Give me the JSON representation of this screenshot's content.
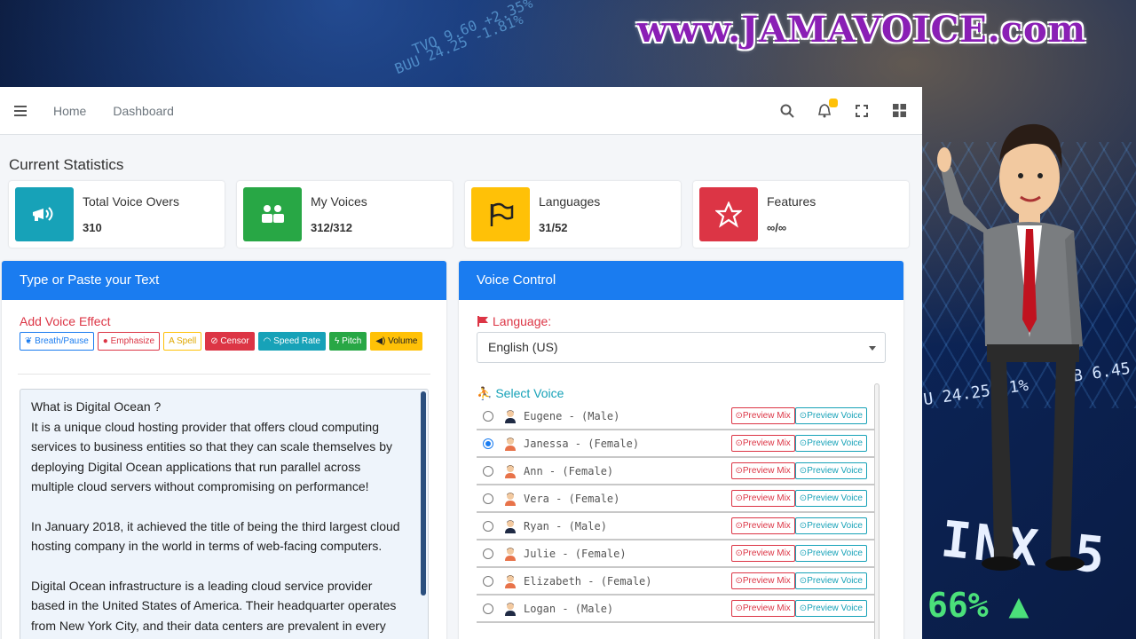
{
  "brand": {
    "text": "www.JAMAVOICE.com"
  },
  "background": {
    "tickers": [
      "BUU 24.25 -1.81%",
      "TVQ 9.60 +2.35%",
      "U 24.25 -1%",
      "UB 6.45"
    ],
    "big_ticker": "INX 5",
    "percent": "66% ▲"
  },
  "topbar": {
    "nav": [
      "Home",
      "Dashboard"
    ],
    "icons": [
      "menu-icon",
      "search-icon",
      "bell-icon",
      "fullscreen-icon",
      "grid-icon"
    ],
    "notification_count": "0"
  },
  "stats": {
    "title": "Current Statistics",
    "items": [
      {
        "label": "Total Voice Overs",
        "value": "310",
        "color": "#17a2b8",
        "icon": "megaphone-icon"
      },
      {
        "label": "My Voices",
        "value": "312/312",
        "color": "#28a745",
        "icon": "users-icon"
      },
      {
        "label": "Languages",
        "value": "31/52",
        "color": "#ffc107",
        "icon": "flag-icon"
      },
      {
        "label": "Features",
        "value": "∞/∞",
        "color": "#dc3545",
        "icon": "star-icon"
      }
    ]
  },
  "text_panel": {
    "title": "Type or Paste your Text",
    "effects_title": "Add Voice Effect",
    "chips": [
      {
        "label": "Breath/Pause",
        "style": "outline-primary"
      },
      {
        "label": "Emphasize",
        "style": "outline-danger"
      },
      {
        "label": "Spell",
        "style": "outline-warning"
      },
      {
        "label": "Censor",
        "style": "danger"
      },
      {
        "label": "Speed Rate",
        "style": "info"
      },
      {
        "label": "Pitch",
        "style": "success"
      },
      {
        "label": "Volume",
        "style": "warning"
      }
    ],
    "paragraphs": [
      "What is Digital Ocean ?\nIt is a unique cloud hosting provider that offers cloud computing services to business entities so that they can scale themselves by deploying Digital Ocean applications that run parallel across multiple cloud servers without compromising on performance!",
      "In January 2018, it achieved the title of being the third largest cloud hosting company in the world in terms of web-facing computers.",
      "Digital Ocean infrastructure is a leading cloud service provider based in the United States of America. Their headquarter operates from New York City, and their data centers are prevalent in every"
    ]
  },
  "voice_panel": {
    "title": "Voice Control",
    "language_label": "Language:",
    "language_value": "English (US)",
    "select_voice_label": "Select Voice",
    "preview_mix_label": "Preview Mix",
    "preview_voice_label": "Preview Voice",
    "voices": [
      {
        "name": "Eugene - (Male)",
        "gender": "male",
        "selected": false
      },
      {
        "name": "Janessa - (Female)",
        "gender": "female",
        "selected": true
      },
      {
        "name": "Ann - (Female)",
        "gender": "female",
        "selected": false
      },
      {
        "name": "Vera - (Female)",
        "gender": "female",
        "selected": false
      },
      {
        "name": "Ryan - (Male)",
        "gender": "male",
        "selected": false
      },
      {
        "name": "Julie - (Female)",
        "gender": "female",
        "selected": false
      },
      {
        "name": "Elizabeth - (Female)",
        "gender": "female",
        "selected": false
      },
      {
        "name": "Logan - (Male)",
        "gender": "male",
        "selected": false
      }
    ]
  }
}
